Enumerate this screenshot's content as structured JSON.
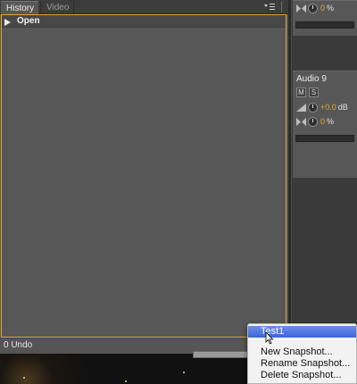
{
  "tabs": [
    {
      "label": "History",
      "close": "×"
    },
    {
      "label": "Video"
    }
  ],
  "panel_menu_icon": "panel-menu-icon",
  "history": {
    "items": [
      {
        "label": "Open",
        "icon": "open-file-icon"
      }
    ],
    "undo_status": "0 Undo"
  },
  "mixer": {
    "top_track": {
      "pan_value": "0",
      "pan_unit": "%"
    },
    "track": {
      "name": "Audio 9",
      "mute_label": "M",
      "solo_label": "S",
      "volume_value": "+0.0",
      "volume_unit": "dB",
      "pan_value": "0",
      "pan_unit": "%"
    }
  },
  "context_menu": {
    "items": [
      {
        "label": "Test1",
        "selected": true
      },
      {
        "label": "New Snapshot..."
      },
      {
        "label": "Rename Snapshot..."
      },
      {
        "label": "Delete Snapshot..."
      }
    ]
  },
  "colors": {
    "accent_orange": "#e2a434",
    "menu_highlight": "#3c66d6"
  }
}
